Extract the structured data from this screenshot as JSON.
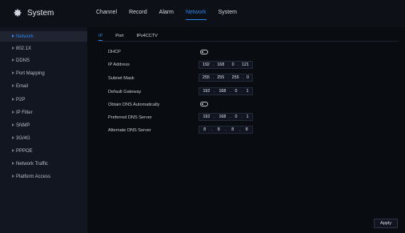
{
  "app": {
    "title": "System",
    "icon": "gear-icon"
  },
  "topnav": {
    "items": [
      {
        "label": "Channel",
        "active": false
      },
      {
        "label": "Record",
        "active": false
      },
      {
        "label": "Alarm",
        "active": false
      },
      {
        "label": "Network",
        "active": true
      },
      {
        "label": "System",
        "active": false
      }
    ]
  },
  "sidebar": {
    "items": [
      {
        "label": "Network",
        "active": true
      },
      {
        "label": "802.1X",
        "active": false
      },
      {
        "label": "DDNS",
        "active": false
      },
      {
        "label": "Port Mapping",
        "active": false
      },
      {
        "label": "Email",
        "active": false
      },
      {
        "label": "P2P",
        "active": false
      },
      {
        "label": "IP Filter",
        "active": false
      },
      {
        "label": "SNMP",
        "active": false
      },
      {
        "label": "3G/4G",
        "active": false
      },
      {
        "label": "PPPOE",
        "active": false
      },
      {
        "label": "Network Traffic",
        "active": false
      },
      {
        "label": "Platform Access",
        "active": false
      }
    ]
  },
  "tabs": [
    {
      "label": "IP",
      "active": true
    },
    {
      "label": "Port",
      "active": false
    },
    {
      "label": "IPv4CCTV",
      "active": false
    }
  ],
  "form": {
    "dhcp_label": "DHCP",
    "ip_address_label": "IP Address",
    "subnet_mask_label": "Subnet Mask",
    "default_gateway_label": "Default Gateway",
    "obtain_dns_label": "Obtain DNS Automatically",
    "preferred_dns_label": "Preferred DNS Server",
    "alternate_dns_label": "Alternate DNS Server",
    "ip_address": [
      "192",
      "168",
      "0",
      "121"
    ],
    "subnet_mask": [
      "255",
      "255",
      "255",
      "0"
    ],
    "default_gateway": [
      "192",
      "168",
      "0",
      "1"
    ],
    "preferred_dns": [
      "192",
      "168",
      "0",
      "1"
    ],
    "alternate_dns": [
      "8",
      "8",
      "8",
      "8"
    ]
  },
  "actions": {
    "apply_label": "Apply"
  },
  "colors": {
    "accent": "#2a83e5",
    "background": "#0b0e14",
    "sidebar": "#121620"
  }
}
